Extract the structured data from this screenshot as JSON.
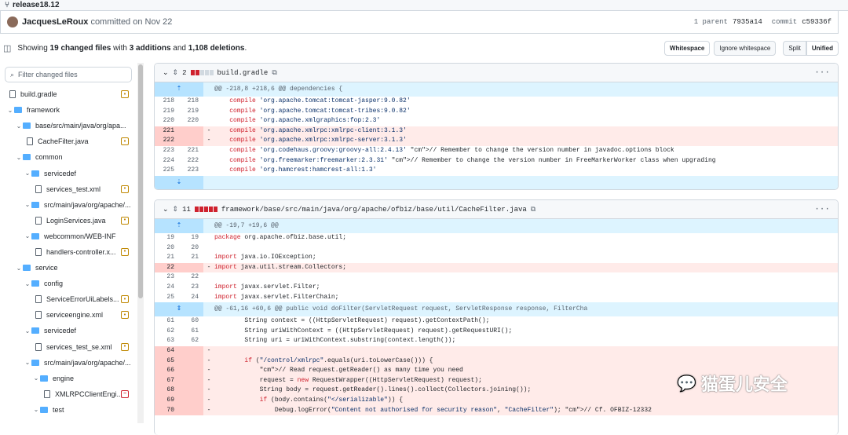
{
  "branch": "release18.12",
  "commit": {
    "author": "JacquesLeRoux",
    "action": "committed on Nov 22",
    "parent": "1 parent",
    "parent_hash": "7935a14",
    "commit_label": "commit",
    "commit_hash": "c59336f"
  },
  "summary": {
    "prefix": "Showing",
    "files": "19 changed files",
    "mid": "with",
    "adds": "3 additions",
    "and": "and",
    "dels": "1,108 deletions",
    "end": "."
  },
  "buttons": {
    "whitespace": "Whitespace",
    "ignore": "Ignore whitespace",
    "split": "Split",
    "unified": "Unified"
  },
  "sidebar": {
    "filter_placeholder": "Filter changed files",
    "items": [
      {
        "label": "build.gradle",
        "type": "file",
        "depth": 0,
        "badge": "mod"
      },
      {
        "label": "framework",
        "type": "folder",
        "depth": 0
      },
      {
        "label": "base/src/main/java/org/apa...",
        "type": "folder",
        "depth": 1
      },
      {
        "label": "CacheFilter.java",
        "type": "file",
        "depth": 2,
        "badge": "mod"
      },
      {
        "label": "common",
        "type": "folder",
        "depth": 1
      },
      {
        "label": "servicedef",
        "type": "folder",
        "depth": 2
      },
      {
        "label": "services_test.xml",
        "type": "file",
        "depth": 3,
        "badge": "mod"
      },
      {
        "label": "src/main/java/org/apache/...",
        "type": "folder",
        "depth": 2
      },
      {
        "label": "LoginServices.java",
        "type": "file",
        "depth": 3,
        "badge": "mod"
      },
      {
        "label": "webcommon/WEB-INF",
        "type": "folder",
        "depth": 2
      },
      {
        "label": "handlers-controller.x...",
        "type": "file",
        "depth": 3,
        "badge": "mod"
      },
      {
        "label": "service",
        "type": "folder",
        "depth": 1
      },
      {
        "label": "config",
        "type": "folder",
        "depth": 2
      },
      {
        "label": "ServiceErrorUiLabels...",
        "type": "file",
        "depth": 3,
        "badge": "mod"
      },
      {
        "label": "serviceengine.xml",
        "type": "file",
        "depth": 3,
        "badge": "mod"
      },
      {
        "label": "servicedef",
        "type": "folder",
        "depth": 2
      },
      {
        "label": "services_test_se.xml",
        "type": "file",
        "depth": 3,
        "badge": "mod"
      },
      {
        "label": "src/main/java/org/apache/...",
        "type": "folder",
        "depth": 2
      },
      {
        "label": "engine",
        "type": "folder",
        "depth": 3
      },
      {
        "label": "XMLRPCClientEngi...",
        "type": "file",
        "depth": 4,
        "badge": "del"
      },
      {
        "label": "test",
        "type": "folder",
        "depth": 3
      }
    ]
  },
  "diff1": {
    "count": "2",
    "filename": "build.gradle",
    "hunk": "@@ -218,8 +218,6 @@ dependencies {",
    "lines": [
      {
        "t": "ctx",
        "a": "218",
        "b": "218",
        "code": "    compile 'org.apache.tomcat:tomcat-jasper:9.0.82'"
      },
      {
        "t": "ctx",
        "a": "219",
        "b": "219",
        "code": "    compile 'org.apache.tomcat:tomcat-tribes:9.0.82'"
      },
      {
        "t": "ctx",
        "a": "220",
        "b": "220",
        "code": "    compile 'org.apache.xmlgraphics:fop:2.3'"
      },
      {
        "t": "del",
        "a": "221",
        "b": "",
        "code": "    compile 'org.apache.xmlrpc:xmlrpc-client:3.1.3'"
      },
      {
        "t": "del",
        "a": "222",
        "b": "",
        "code": "    compile 'org.apache.xmlrpc:xmlrpc-server:3.1.3'"
      },
      {
        "t": "ctx",
        "a": "223",
        "b": "221",
        "code": "    compile 'org.codehaus.groovy:groovy-all:2.4.13' // Remember to change the version number in javadoc.options block"
      },
      {
        "t": "ctx",
        "a": "224",
        "b": "222",
        "code": "    compile 'org.freemarker:freemarker:2.3.31' // Remember to change the version number in FreeMarkerWorker class when upgrading"
      },
      {
        "t": "ctx",
        "a": "225",
        "b": "223",
        "code": "    compile 'org.hamcrest:hamcrest-all:1.3'"
      }
    ]
  },
  "diff2": {
    "count": "11",
    "filename": "framework/base/src/main/java/org/apache/ofbiz/base/util/CacheFilter.java",
    "hunk1": "@@ -19,7 +19,6 @@",
    "hunk2": "@@ -61,16 +60,6 @@ public void doFilter(ServletRequest request, ServletResponse response, FilterCha",
    "lines1": [
      {
        "t": "ctx",
        "a": "19",
        "b": "19",
        "code": "package org.apache.ofbiz.base.util;"
      },
      {
        "t": "ctx",
        "a": "20",
        "b": "20",
        "code": ""
      },
      {
        "t": "ctx",
        "a": "21",
        "b": "21",
        "code": "import java.io.IOException;"
      },
      {
        "t": "del",
        "a": "22",
        "b": "",
        "code": "import java.util.stream.Collectors;"
      },
      {
        "t": "ctx",
        "a": "23",
        "b": "22",
        "code": ""
      },
      {
        "t": "ctx",
        "a": "24",
        "b": "23",
        "code": "import javax.servlet.Filter;"
      },
      {
        "t": "ctx",
        "a": "25",
        "b": "24",
        "code": "import javax.servlet.FilterChain;"
      }
    ],
    "lines2": [
      {
        "t": "ctx",
        "a": "61",
        "b": "60",
        "code": "        String context = ((HttpServletRequest) request).getContextPath();"
      },
      {
        "t": "ctx",
        "a": "62",
        "b": "61",
        "code": "        String uriWithContext = ((HttpServletRequest) request).getRequestURI();"
      },
      {
        "t": "ctx",
        "a": "63",
        "b": "62",
        "code": "        String uri = uriWithContext.substring(context.length());"
      },
      {
        "t": "del",
        "a": "64",
        "b": "",
        "code": ""
      },
      {
        "t": "del",
        "a": "65",
        "b": "",
        "code": "        if (\"/control/xmlrpc\".equals(uri.toLowerCase())) {"
      },
      {
        "t": "del",
        "a": "66",
        "b": "",
        "code": "            // Read request.getReader() as many time you need"
      },
      {
        "t": "del",
        "a": "67",
        "b": "",
        "code": "            request = new RequestWrapper((HttpServletRequest) request);"
      },
      {
        "t": "del",
        "a": "68",
        "b": "",
        "code": "            String body = request.getReader().lines().collect(Collectors.joining());"
      },
      {
        "t": "del",
        "a": "69",
        "b": "",
        "code": "            if (body.contains(\"</serializable\")) {"
      },
      {
        "t": "del",
        "a": "70",
        "b": "",
        "code": "                Debug.logError(\"Content not authorised for security reason\", \"CacheFilter\"); // Cf. OFBIZ-12332"
      }
    ]
  },
  "watermark": "猫蛋儿安全"
}
